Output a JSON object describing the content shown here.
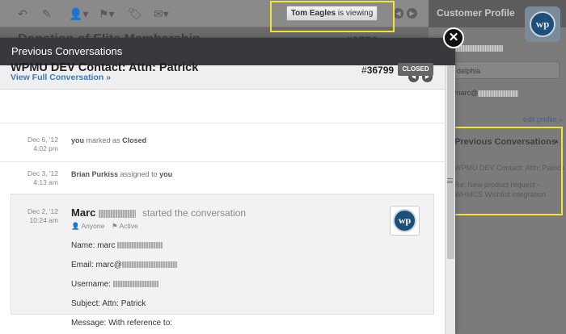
{
  "toolbar": {
    "icons": [
      "undo-icon",
      "edit-icon",
      "user-icon",
      "flag-icon",
      "tag-icon",
      "mail-icon"
    ],
    "viewing": {
      "name": "Tom Eagles",
      "suffix": "is viewing"
    }
  },
  "background": {
    "title": "Donation of Elite Membership",
    "number": "#3778"
  },
  "sidebar": {
    "header": "Customer Profile",
    "logo_text": "wp",
    "location": "delphia",
    "email_prefix": "marc@",
    "edit_profile": "edit profile »",
    "section_title": "Previous Conversations",
    "items": [
      "WPMU DEV Contact: Attn: Patrick",
      "Re: New product request - WHMCS Wishlist integration"
    ]
  },
  "modal": {
    "title": "Previous Conversations",
    "view_full": "View Full Conversation »",
    "conv_title": "WPMU DEV Contact: Attn: Patrick",
    "conv_number": "36799",
    "status": "CLOSED",
    "events": [
      {
        "date": "Dec 6, '12",
        "time": "4:02 pm",
        "actor": "you",
        "action": "marked as",
        "target": "Closed"
      },
      {
        "date": "Dec 3, '12",
        "time": "4:13 am",
        "actor": "Brian Purkiss",
        "action": "assigned to",
        "target": "you"
      }
    ],
    "message": {
      "date": "Dec 2, '12",
      "time": "10:24 am",
      "sender_first": "Marc",
      "started": "started the conversation",
      "visibility": "Anyone",
      "state": "Active",
      "avatar_text": "wp",
      "name_label": "Name: marc",
      "email_label": "Email: marc@",
      "username_label": "Username:",
      "subject": "Subject: Attn: Patrick",
      "message_line": "Message: With reference to:"
    }
  },
  "colors": {
    "link": "#3d7bb8",
    "header": "#37393c",
    "highlight": "#f2e233",
    "badge": "#666666"
  }
}
